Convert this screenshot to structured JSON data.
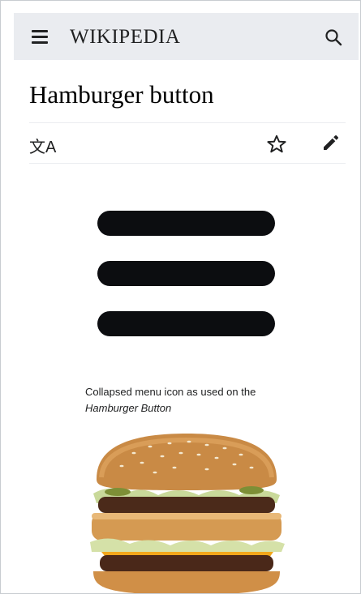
{
  "header": {
    "wordmark": "WIKIPEDIA",
    "menu_icon": "hamburger-menu-icon",
    "search_icon": "search-icon"
  },
  "article": {
    "title": "Hamburger button"
  },
  "toolbar": {
    "language_icon": "language-icon",
    "language_glyph": "文A",
    "watch_icon": "star-icon",
    "edit_icon": "pencil-icon"
  },
  "figure": {
    "caption_line1": "Collapsed menu icon as used on the",
    "caption_line2": "Hamburger Button"
  },
  "colors": {
    "header_bg": "#eaecf0",
    "icon_bars": "#0c0d10",
    "text": "#202122"
  }
}
